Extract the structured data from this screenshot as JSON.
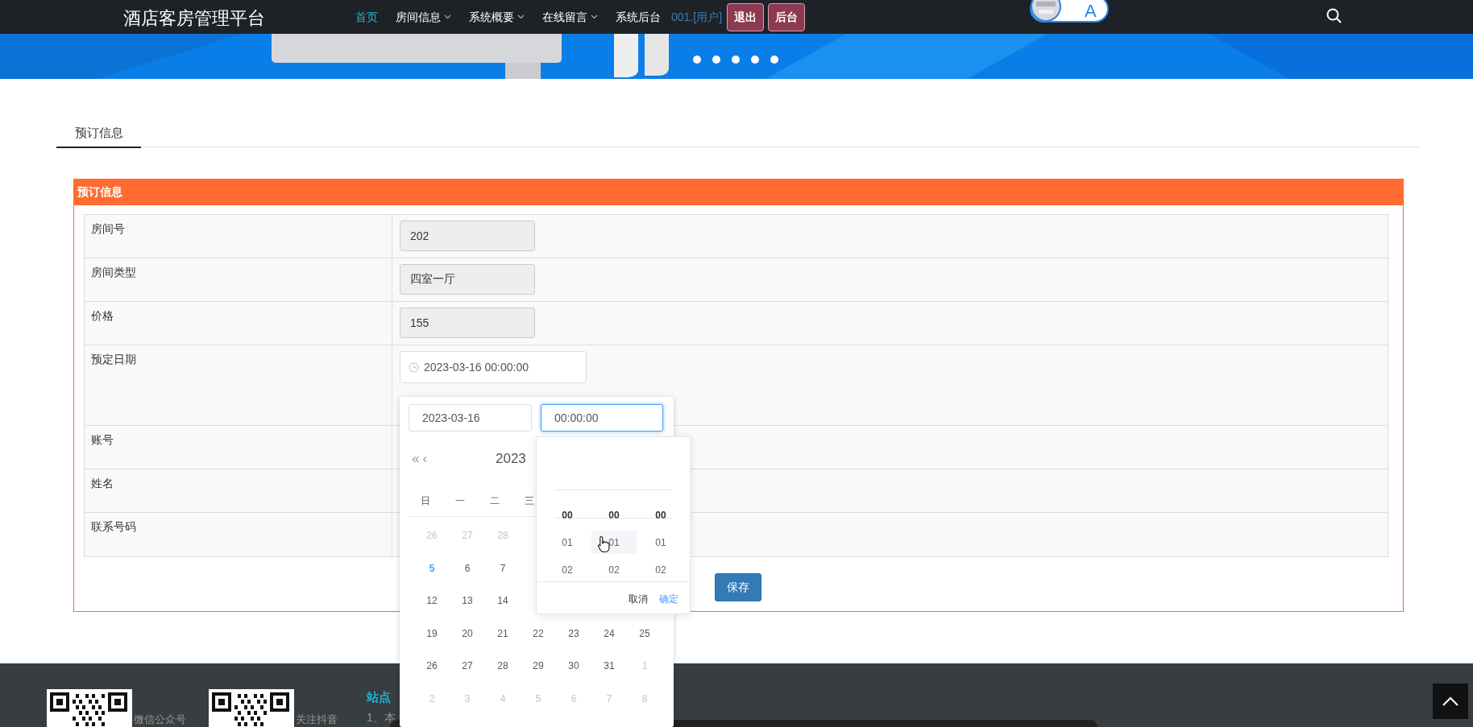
{
  "navbar": {
    "brand": "酒店客房管理平台",
    "items": [
      {
        "label": "首页",
        "selected": true,
        "dropdown": false
      },
      {
        "label": "房间信息",
        "selected": false,
        "dropdown": true
      },
      {
        "label": "系统概要",
        "selected": false,
        "dropdown": true
      },
      {
        "label": "在线留言",
        "selected": false,
        "dropdown": true
      },
      {
        "label": "系统后台",
        "selected": false,
        "dropdown": false
      }
    ],
    "user": "001.[用户]",
    "buttons": [
      "退出",
      "后台"
    ],
    "avatar_badge": "A"
  },
  "tabs": [
    {
      "label": "预订信息",
      "selected": true
    }
  ],
  "panel": {
    "title": "预订信息",
    "fields": [
      {
        "label": "房间号",
        "kind": "readonly",
        "value": "202"
      },
      {
        "label": "房间类型",
        "kind": "readonly",
        "value": "四室一厅"
      },
      {
        "label": "价格",
        "kind": "readonly",
        "value": "155"
      },
      {
        "label": "预定日期",
        "kind": "datetime",
        "value": "2023-03-16 00:00:00"
      },
      {
        "label": "账号",
        "kind": "covered"
      },
      {
        "label": "姓名",
        "kind": "covered"
      },
      {
        "label": "联系号码",
        "kind": "covered"
      }
    ],
    "save_button": "保存"
  },
  "datepicker": {
    "date_value": "2023-03-16",
    "time_value": "00:00:00",
    "time_focused": true,
    "prev_year": "«",
    "prev_month": "‹",
    "year": "2023",
    "weekdays": [
      "日",
      "一",
      "二",
      "三"
    ],
    "weeks": [
      {
        "days": [
          {
            "day": "26",
            "kind": "other"
          },
          {
            "day": "27",
            "kind": "other"
          },
          {
            "day": "28",
            "kind": "other"
          }
        ]
      },
      {
        "days": [
          {
            "day": "5",
            "kind": "today"
          },
          {
            "day": "6",
            "kind": "day"
          },
          {
            "day": "7",
            "kind": "day"
          }
        ]
      },
      {
        "days": [
          {
            "day": "12",
            "kind": "day"
          },
          {
            "day": "13",
            "kind": "day"
          },
          {
            "day": "14",
            "kind": "day"
          }
        ]
      },
      {
        "days": [
          {
            "day": "19",
            "kind": "day"
          },
          {
            "day": "20",
            "kind": "day"
          },
          {
            "day": "21",
            "kind": "day"
          },
          {
            "day": "22",
            "kind": "day"
          },
          {
            "day": "23",
            "kind": "day"
          },
          {
            "day": "24",
            "kind": "day"
          },
          {
            "day": "25",
            "kind": "day"
          }
        ]
      },
      {
        "days": [
          {
            "day": "26",
            "kind": "day"
          },
          {
            "day": "27",
            "kind": "day"
          },
          {
            "day": "28",
            "kind": "day"
          },
          {
            "day": "29",
            "kind": "day"
          },
          {
            "day": "30",
            "kind": "day"
          },
          {
            "day": "31",
            "kind": "day"
          },
          {
            "day": "1",
            "kind": "other"
          }
        ]
      },
      {
        "days": [
          {
            "day": "2",
            "kind": "other"
          },
          {
            "day": "3",
            "kind": "other"
          },
          {
            "day": "4",
            "kind": "other"
          },
          {
            "day": "5",
            "kind": "other"
          },
          {
            "day": "6",
            "kind": "other"
          },
          {
            "day": "7",
            "kind": "other"
          },
          {
            "day": "8",
            "kind": "other"
          }
        ]
      }
    ],
    "time_columns": [
      {
        "options": [
          {
            "label": "00",
            "selected": true,
            "hovered": false
          },
          {
            "label": "01",
            "selected": false,
            "hovered": false
          },
          {
            "label": "02",
            "selected": false,
            "hovered": false
          }
        ]
      },
      {
        "options": [
          {
            "label": "00",
            "selected": true,
            "hovered": false
          },
          {
            "label": "01",
            "selected": false,
            "hovered": true
          },
          {
            "label": "02",
            "selected": false,
            "hovered": false
          }
        ]
      },
      {
        "options": [
          {
            "label": "00",
            "selected": true,
            "hovered": false
          },
          {
            "label": "01",
            "selected": false,
            "hovered": false
          },
          {
            "label": "02",
            "selected": false,
            "hovered": false
          }
        ]
      }
    ],
    "cancel": "取消",
    "confirm": "确定"
  },
  "footer": {
    "qr_labels": [
      "微信公众号",
      "关注抖音"
    ],
    "heading": "站点",
    "text": "1、本"
  }
}
